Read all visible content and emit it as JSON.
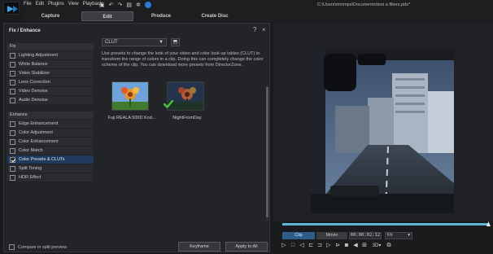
{
  "app": {
    "menu": [
      "File",
      "Edit",
      "Plugins",
      "View",
      "Playback"
    ],
    "file_path": "C:\\Users\\mmmps\\Documents\\test a filters.pds*"
  },
  "modes": {
    "tabs": [
      {
        "label": "Capture",
        "active": false
      },
      {
        "label": "Edit",
        "active": true
      },
      {
        "label": "Produce",
        "active": false
      },
      {
        "label": "Create Disc",
        "active": false
      }
    ]
  },
  "panel": {
    "title": "Fix / Enhance",
    "help": "?",
    "close": "×",
    "fix_header": "Fix",
    "fix_items": [
      {
        "label": "Lighting Adjustment",
        "checked": false
      },
      {
        "label": "White Balance",
        "checked": false
      },
      {
        "label": "Video Stabilizer",
        "checked": false
      },
      {
        "label": "Lens Correction",
        "checked": false
      },
      {
        "label": "Video Denoise",
        "checked": false
      },
      {
        "label": "Audio Denoise",
        "checked": false
      }
    ],
    "enhance_header": "Enhance",
    "enhance_items": [
      {
        "label": "Edge Enhancement",
        "checked": false
      },
      {
        "label": "Color Adjustment",
        "checked": false
      },
      {
        "label": "Color Enhancement",
        "checked": false
      },
      {
        "label": "Color Match",
        "checked": false
      },
      {
        "label": "Color Presets & CLUTs",
        "checked": true
      },
      {
        "label": "Split Toning",
        "checked": false
      },
      {
        "label": "HDR Effect",
        "checked": false
      }
    ],
    "dropdown_value": "CLUT",
    "description": "Use presets to change the look of your video and color look-up tables (CLUT) to transform the range of colors in a clip. Doing this can completely change the color scheme of the clip. You can download more presets from DirectorZone.",
    "presets": [
      {
        "label": "Fuji REALA 500D Kod...",
        "applied": false
      },
      {
        "label": "NightFromDay",
        "applied": true
      }
    ],
    "compare_label": "Compare in split preview",
    "keyframe_label": "Keyframe",
    "apply_all_label": "Apply to All"
  },
  "preview": {
    "clip_label": "Clip",
    "movie_label": "Movie",
    "timecode": "00;00;02;12",
    "fit_label": "Fit",
    "threed_label": "3D"
  }
}
